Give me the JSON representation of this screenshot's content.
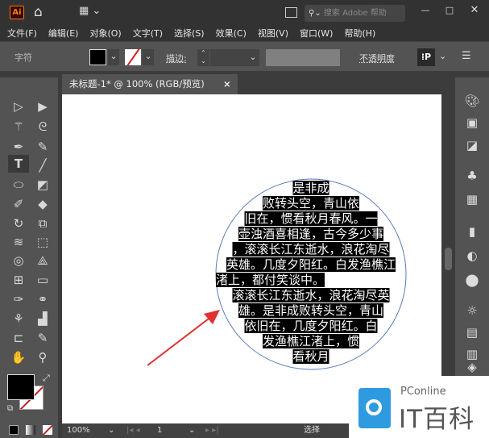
{
  "app": {
    "logo": "Ai",
    "search_placeholder": "搜索 Adobe 帮助"
  },
  "menu": [
    "文件(F)",
    "编辑(E)",
    "对象(O)",
    "文字(T)",
    "选择(S)",
    "效果(C)",
    "视图(V)",
    "窗口(W)",
    "帮助(H)"
  ],
  "control": {
    "panel_label": "字符",
    "stroke_label": "描边",
    "stroke_colon": ":",
    "opacity_label": "不透明度"
  },
  "tab": {
    "title": "未标题-1* @ 100% (RGB/预览)",
    "close": "×"
  },
  "text_lines": [
    "是非成",
    "败转头空，青山依",
    "旧在，惯看秋月春风。一",
    "壶浊酒喜相逢，古今多少事",
    "，滚滚长江东逝水，浪花淘尽",
    "英雄。几度夕阳红。白发渔樵江",
    "渚上，都付笑谈中。",
    "滚滚长江东逝水，浪花淘尽英",
    "雄。是非成败转头空，青山",
    "依旧在，几度夕阳红。白",
    "发渔樵江渚上，惯",
    "看秋月"
  ],
  "status": {
    "zoom": "100%",
    "page": "1",
    "mode": "选择"
  },
  "watermark": {
    "brand": "PConline",
    "name": "IT百科"
  },
  "colors": {
    "accent_arrow": "#e03030",
    "circle": "#5a7ab8"
  }
}
